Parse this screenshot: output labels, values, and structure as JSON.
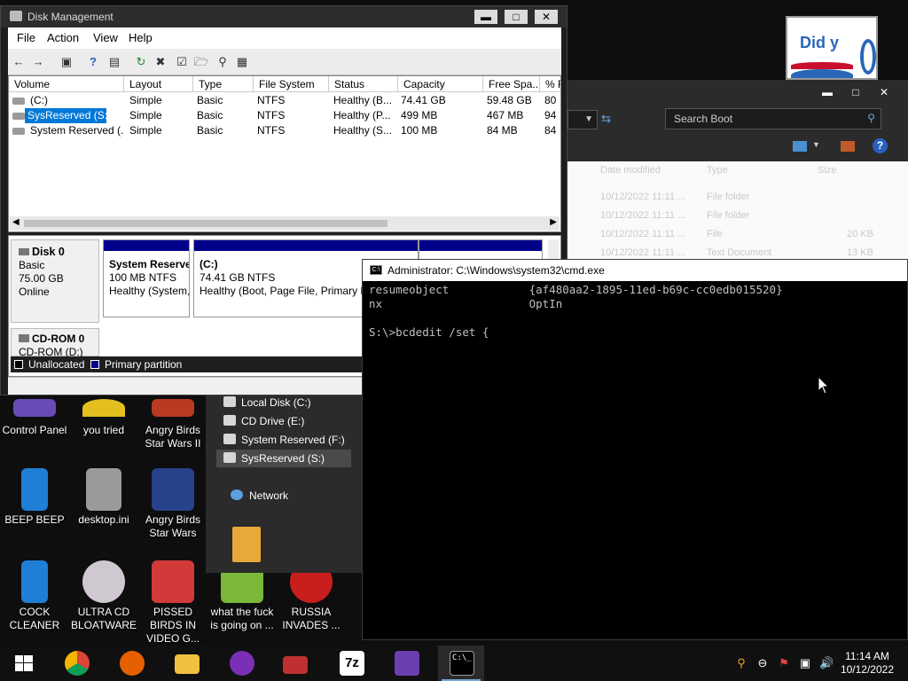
{
  "disk_mgmt": {
    "title": "Disk Management",
    "menu": [
      "File",
      "Action",
      "View",
      "Help"
    ],
    "columns": [
      "Volume",
      "Layout",
      "Type",
      "File System",
      "Status",
      "Capacity",
      "Free Spa...",
      "% F"
    ],
    "rows": [
      {
        "volume": "(C:)",
        "layout": "Simple",
        "type": "Basic",
        "fs": "NTFS",
        "status": "Healthy (B...",
        "capacity": "74.41 GB",
        "free": "59.48 GB",
        "pct": "80"
      },
      {
        "volume": "SysReserved (S:)",
        "layout": "Simple",
        "type": "Basic",
        "fs": "NTFS",
        "status": "Healthy (P...",
        "capacity": "499 MB",
        "free": "467 MB",
        "pct": "94"
      },
      {
        "volume": "System Reserved (...",
        "layout": "Simple",
        "type": "Basic",
        "fs": "NTFS",
        "status": "Healthy (S...",
        "capacity": "100 MB",
        "free": "84 MB",
        "pct": "84"
      }
    ],
    "disk0": {
      "name": "Disk 0",
      "type": "Basic",
      "size": "75.00 GB",
      "state": "Online"
    },
    "partitions": [
      {
        "name": "System Reserve",
        "size": "100 MB NTFS",
        "status": "Healthy (System,"
      },
      {
        "name": "(C:)",
        "size": "74.41 GB NTFS",
        "status": "Healthy (Boot, Page File, Primary P"
      }
    ],
    "cdrom": {
      "name": "CD-ROM 0",
      "drive": "CD-ROM (D:)"
    },
    "legend": [
      "Unallocated",
      "Primary partition"
    ]
  },
  "explorer": {
    "search_placeholder": "Search Boot",
    "headers": [
      "Date modified",
      "Type",
      "Size"
    ],
    "rows": [
      {
        "date": "10/12/2022 11:11 ...",
        "type": "File folder",
        "size": ""
      },
      {
        "date": "10/12/2022 11:11 ...",
        "type": "File folder",
        "size": ""
      },
      {
        "date": "10/12/2022 11:11 ...",
        "type": "File",
        "size": "20 KB"
      },
      {
        "date": "10/12/2022 11:11 ...",
        "type": "Text Document",
        "size": "13 KB"
      }
    ],
    "nav": [
      "Local Disk (C:)",
      "CD Drive (E:)",
      "System Reserved (F:)",
      "SysReserved (S:)"
    ],
    "network": "Network"
  },
  "cmd": {
    "title": "Administrator: C:\\Windows\\system32\\cmd.exe",
    "text": "resumeobject            {af480aa2-1895-11ed-b69c-cc0edb015520}\nnx                      OptIn\n\nS:\\>bcdedit /set {"
  },
  "thumbnail": {
    "text": "Did y"
  },
  "desktop_icons": [
    {
      "label": "Control Panel"
    },
    {
      "label": "you tried"
    },
    {
      "label": "Angry Birds Star Wars II"
    },
    {
      "label": "BEEP BEEP"
    },
    {
      "label": "desktop.ini"
    },
    {
      "label": "Angry Birds Star Wars"
    },
    {
      "label": "COCK CLEANER"
    },
    {
      "label": "ULTRA CD BLOATWARE"
    },
    {
      "label": "PISSED BIRDS IN VIDEO G..."
    },
    {
      "label": "what the fuck is going on ..."
    },
    {
      "label": "RUSSIA INVADES ..."
    }
  ],
  "taskbar": {
    "cmd_icon_text": "C:\\_",
    "zip_text": "7z",
    "time": "11:14 AM",
    "date": "10/12/2022"
  },
  "colors": {
    "cmd_bg": "#000000",
    "partition_bar": "#00008b",
    "selection": "#0078d7"
  }
}
